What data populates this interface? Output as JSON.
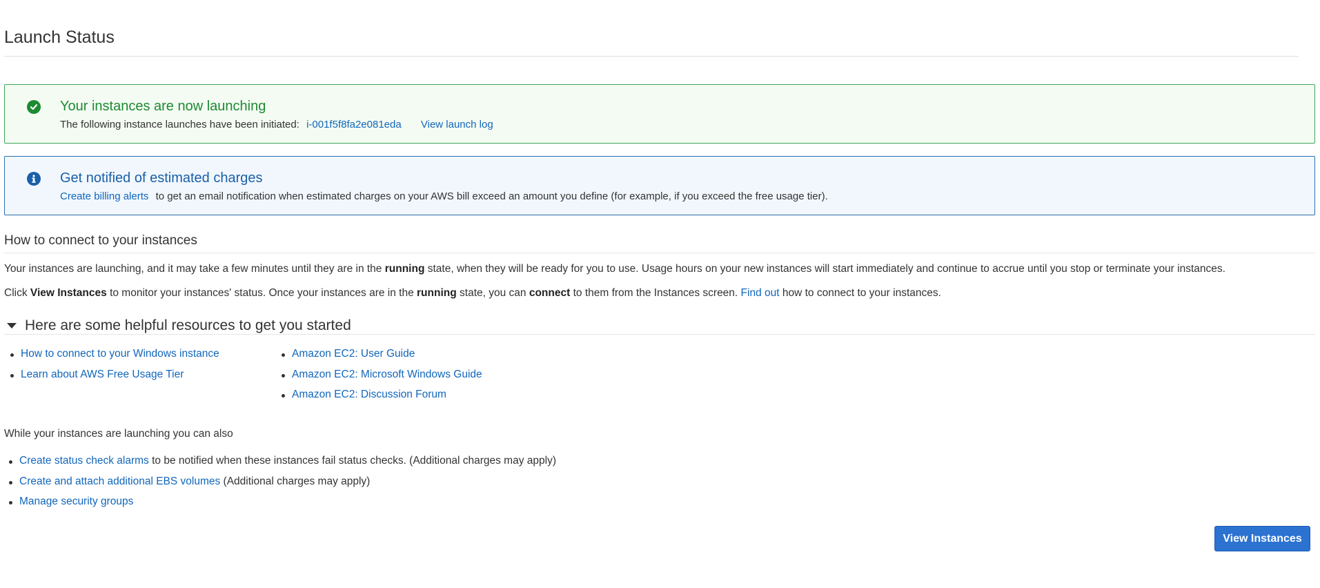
{
  "page": {
    "title": "Launch Status"
  },
  "success_alert": {
    "heading": "Your instances are now launching",
    "body_text": "The following instance launches have been initiated:",
    "instance_id": "i-001f5f8fa2e081eda",
    "log_link": "View launch log"
  },
  "info_alert": {
    "link": "Create billing alerts",
    "heading": "Get notified of estimated charges",
    "body_text": "to get an email notification when estimated charges on your AWS bill exceed an amount you define (for example, if you exceed the free usage tier)."
  },
  "connect": {
    "heading": "How to connect to your instances",
    "p1_a": "Your instances are launching, and it may take a few minutes until they are in the",
    "p1_bold": "running",
    "p1_b": "state, when they will be ready for you to use. Usage hours on your new instances will start immediately and continue to accrue until you stop or terminate your instances.",
    "p2_a": "Click",
    "p2_bold1": "View Instances",
    "p2_b": "to monitor your instances' status. Once your instances are in the",
    "p2_bold2": "running",
    "p2_c": "state, you can",
    "p2_bold3": "connect",
    "p2_d": "to them from the Instances screen.",
    "p2_link": "Find out",
    "p2_e": "how to connect to your instances."
  },
  "resources": {
    "heading": "Here are some helpful resources to get you started",
    "left": [
      "How to connect to your Windows instance",
      "Learn about AWS Free Usage Tier"
    ],
    "right": [
      "Amazon EC2: User Guide",
      "Amazon EC2: Microsoft Windows Guide",
      "Amazon EC2: Discussion Forum"
    ]
  },
  "also": {
    "heading": "While your instances are launching you can also",
    "items": [
      {
        "link": "Create status check alarms",
        "text": "to be notified when these instances fail status checks. (Additional charges may apply)"
      },
      {
        "link": "Create and attach additional EBS volumes",
        "text": "(Additional charges may apply)"
      },
      {
        "link": "Manage security groups",
        "text": ""
      }
    ]
  },
  "actions": {
    "view_instances": "View Instances"
  },
  "colors": {
    "success": "#1d8a32",
    "info": "#1a5fa8",
    "link": "#1166bb",
    "primary_button": "#2b72d1"
  },
  "icons": {
    "success": "check-circle-icon",
    "info": "info-circle-icon",
    "toggle": "caret-down-icon"
  }
}
